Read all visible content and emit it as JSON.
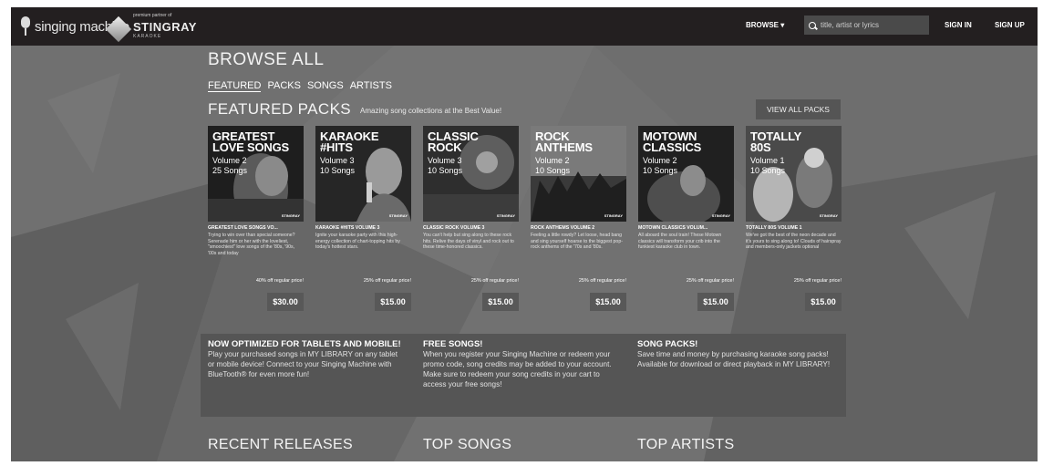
{
  "header": {
    "logo_text": "singing machine",
    "partner_small": "premium partner of",
    "partner_name": "STINGRAY",
    "partner_sub": "KARAOKE",
    "browse_label": "BROWSE ▾",
    "search_placeholder": "title, artist or lyrics",
    "signin_label": "SIGN IN",
    "signup_label": "SIGN UP"
  },
  "page_title": "BROWSE ALL",
  "tabs": [
    {
      "label": "FEATURED",
      "active": true
    },
    {
      "label": "PACKS"
    },
    {
      "label": "SONGS"
    },
    {
      "label": "ARTISTS"
    }
  ],
  "featured": {
    "title": "FEATURED PACKS",
    "subtitle": "Amazing song collections at the Best Value!",
    "view_all_label": "VIEW ALL PACKS"
  },
  "packs": [
    {
      "cover_title_1": "GREATEST",
      "cover_title_2": "LOVE SONGS",
      "cover_vol": "Volume 2",
      "cover_count": "25 Songs",
      "badge": "STINGRAY",
      "name": "GREATEST LOVE SONGS VO...",
      "desc": "Trying to win over than special someone? Serenade him or her with the loveliest, \"smoochiest\" love songs of the '80s, '90s, '00s and today",
      "discount": "40% off regular price!",
      "price": "$30.00"
    },
    {
      "cover_title_1": "KARAOKE",
      "cover_title_2": "#HITS",
      "cover_vol": "Volume 3",
      "cover_count": "10 Songs",
      "badge": "STINGRAY",
      "name": "KARAOKE #HITS VOLUME 3",
      "desc": "Ignite your karaoke party with this high-energy collection of chart-topping hits by today's hottest stars.",
      "discount": "25% off regular price!",
      "price": "$15.00"
    },
    {
      "cover_title_1": "CLASSIC",
      "cover_title_2": "ROCK",
      "cover_vol": "Volume 3",
      "cover_count": "10 Songs",
      "badge": "STINGRAY",
      "name": "CLASSIC ROCK VOLUME 3",
      "desc": "You can't help but sing along to these rock hits. Relive the days of vinyl and rock out to these time-honored classics.",
      "discount": "25% off regular price!",
      "price": "$15.00"
    },
    {
      "cover_title_1": "ROCK",
      "cover_title_2": "ANTHEMS",
      "cover_vol": "Volume 2",
      "cover_count": "10 Songs",
      "badge": "STINGRAY",
      "name": "ROCK ANTHEMS VOLUME 2",
      "desc": "Feeling a little rowdy? Let loose, head bang and sing yourself hoarse to the biggest pop-rock anthems of the '70s and '80s.",
      "discount": "25% off regular price!",
      "price": "$15.00"
    },
    {
      "cover_title_1": "MOTOWN",
      "cover_title_2": "CLASSICS",
      "cover_vol": "Volume 2",
      "cover_count": "10 Songs",
      "badge": "STINGRAY",
      "name": "MOTOWN CLASSICS VOLUM...",
      "desc": "All aboard the soul train! These Motown classics will transform your crib into the funkiest karaoke club in town.",
      "discount": "25% off regular price!",
      "price": "$15.00"
    },
    {
      "cover_title_1": "TOTALLY",
      "cover_title_2": "80s",
      "cover_vol": "Volume 1",
      "cover_count": "10 Songs",
      "badge": "STINGRAY",
      "name": "TOTALLY 80S VOLUME 1",
      "desc": "We've got the best of the neon decade and it's yours to sing along to! Clouds of hairspray and members-only jackets optional",
      "discount": "25% off regular price!",
      "price": "$15.00"
    }
  ],
  "info": [
    {
      "title": "NOW OPTIMIZED FOR TABLETS AND MOBILE!",
      "text": "Play your purchased songs in MY LIBRARY on any tablet or mobile device! Connect to your Singing Machine with BlueTooth® for even more fun!"
    },
    {
      "title": "FREE SONGS!",
      "text": "When you register your Singing Machine or redeem your promo code, song credits may be added to your account. Make sure to redeem your song credits in your cart to access your free songs!"
    },
    {
      "title": "SONG PACKS!",
      "text": "Save time and money by purchasing karaoke song packs! Available for download or direct playback in MY LIBRARY!"
    }
  ],
  "bottom_sections": {
    "recent": "RECENT RELEASES",
    "top_songs": "TOP SONGS",
    "top_artists": "TOP ARTISTS"
  }
}
